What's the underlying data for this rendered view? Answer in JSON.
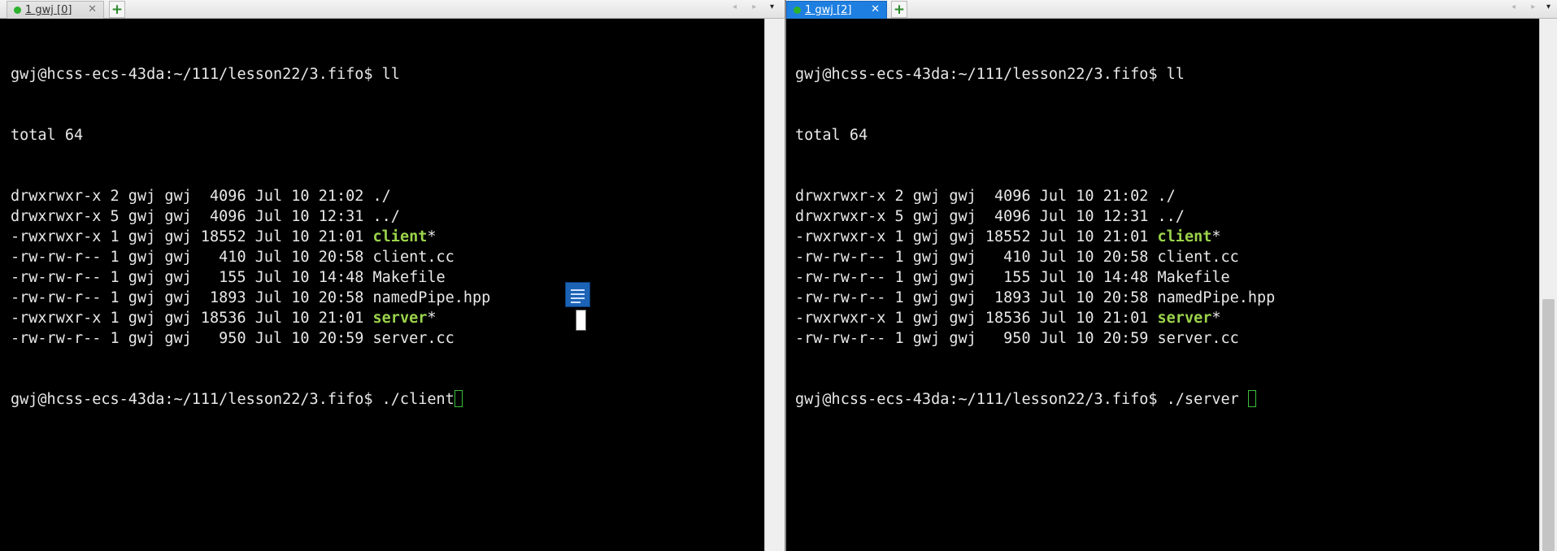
{
  "left_pane": {
    "tab": {
      "label": "1 gwj [0]",
      "close": "✕"
    },
    "add_tab": "+",
    "nav": "◂ ▸",
    "menu": "▾",
    "prompt": "gwj@hcss-ecs-43da:~/111/lesson22/3.fifo$ ",
    "command1": "ll",
    "total": "total 64",
    "listing": [
      {
        "perm": "drwxrwxr-x 2 gwj gwj  4096 Jul 10 21:02 ",
        "name": "./",
        "exe": false,
        "suffix": ""
      },
      {
        "perm": "drwxrwxr-x 5 gwj gwj  4096 Jul 10 12:31 ",
        "name": "../",
        "exe": false,
        "suffix": ""
      },
      {
        "perm": "-rwxrwxr-x 1 gwj gwj 18552 Jul 10 21:01 ",
        "name": "client",
        "exe": true,
        "suffix": "*"
      },
      {
        "perm": "-rw-rw-r-- 1 gwj gwj   410 Jul 10 20:58 ",
        "name": "client.cc",
        "exe": false,
        "suffix": ""
      },
      {
        "perm": "-rw-rw-r-- 1 gwj gwj   155 Jul 10 14:48 ",
        "name": "Makefile",
        "exe": false,
        "suffix": ""
      },
      {
        "perm": "-rw-rw-r-- 1 gwj gwj  1893 Jul 10 20:58 ",
        "name": "namedPipe.hpp",
        "exe": false,
        "suffix": ""
      },
      {
        "perm": "-rwxrwxr-x 1 gwj gwj 18536 Jul 10 21:01 ",
        "name": "server",
        "exe": true,
        "suffix": "*"
      },
      {
        "perm": "-rw-rw-r-- 1 gwj gwj   950 Jul 10 20:59 ",
        "name": "server.cc",
        "exe": false,
        "suffix": ""
      }
    ],
    "command2": "./client"
  },
  "right_pane": {
    "tab": {
      "label": "1 gwj [2]",
      "close": "✕"
    },
    "add_tab": "+",
    "nav": "◂ ▸",
    "menu": "▾",
    "prompt": "gwj@hcss-ecs-43da:~/111/lesson22/3.fifo$ ",
    "command1": "ll",
    "total": "total 64",
    "listing": [
      {
        "perm": "drwxrwxr-x 2 gwj gwj  4096 Jul 10 21:02 ",
        "name": "./",
        "exe": false,
        "suffix": ""
      },
      {
        "perm": "drwxrwxr-x 5 gwj gwj  4096 Jul 10 12:31 ",
        "name": "../",
        "exe": false,
        "suffix": ""
      },
      {
        "perm": "-rwxrwxr-x 1 gwj gwj 18552 Jul 10 21:01 ",
        "name": "client",
        "exe": true,
        "suffix": "*"
      },
      {
        "perm": "-rw-rw-r-- 1 gwj gwj   410 Jul 10 20:58 ",
        "name": "client.cc",
        "exe": false,
        "suffix": ""
      },
      {
        "perm": "-rw-rw-r-- 1 gwj gwj   155 Jul 10 14:48 ",
        "name": "Makefile",
        "exe": false,
        "suffix": ""
      },
      {
        "perm": "-rw-rw-r-- 1 gwj gwj  1893 Jul 10 20:58 ",
        "name": "namedPipe.hpp",
        "exe": false,
        "suffix": ""
      },
      {
        "perm": "-rwxrwxr-x 1 gwj gwj 18536 Jul 10 21:01 ",
        "name": "server",
        "exe": true,
        "suffix": "*"
      },
      {
        "perm": "-rw-rw-r-- 1 gwj gwj   950 Jul 10 20:59 ",
        "name": "server.cc",
        "exe": false,
        "suffix": ""
      }
    ],
    "command2": "./server "
  },
  "colors": {
    "terminal_bg": "#000000",
    "terminal_fg": "#e8e8e8",
    "executable": "#9bd44b",
    "cursor": "#38c038",
    "active_tab": "#1e7fe0",
    "session_dot": "#2cb22c"
  },
  "icons": [
    "session-status-dot",
    "close-icon",
    "add-tab-icon",
    "scroll-left-icon",
    "scroll-right-icon",
    "tab-menu-icon",
    "document-icon"
  ]
}
